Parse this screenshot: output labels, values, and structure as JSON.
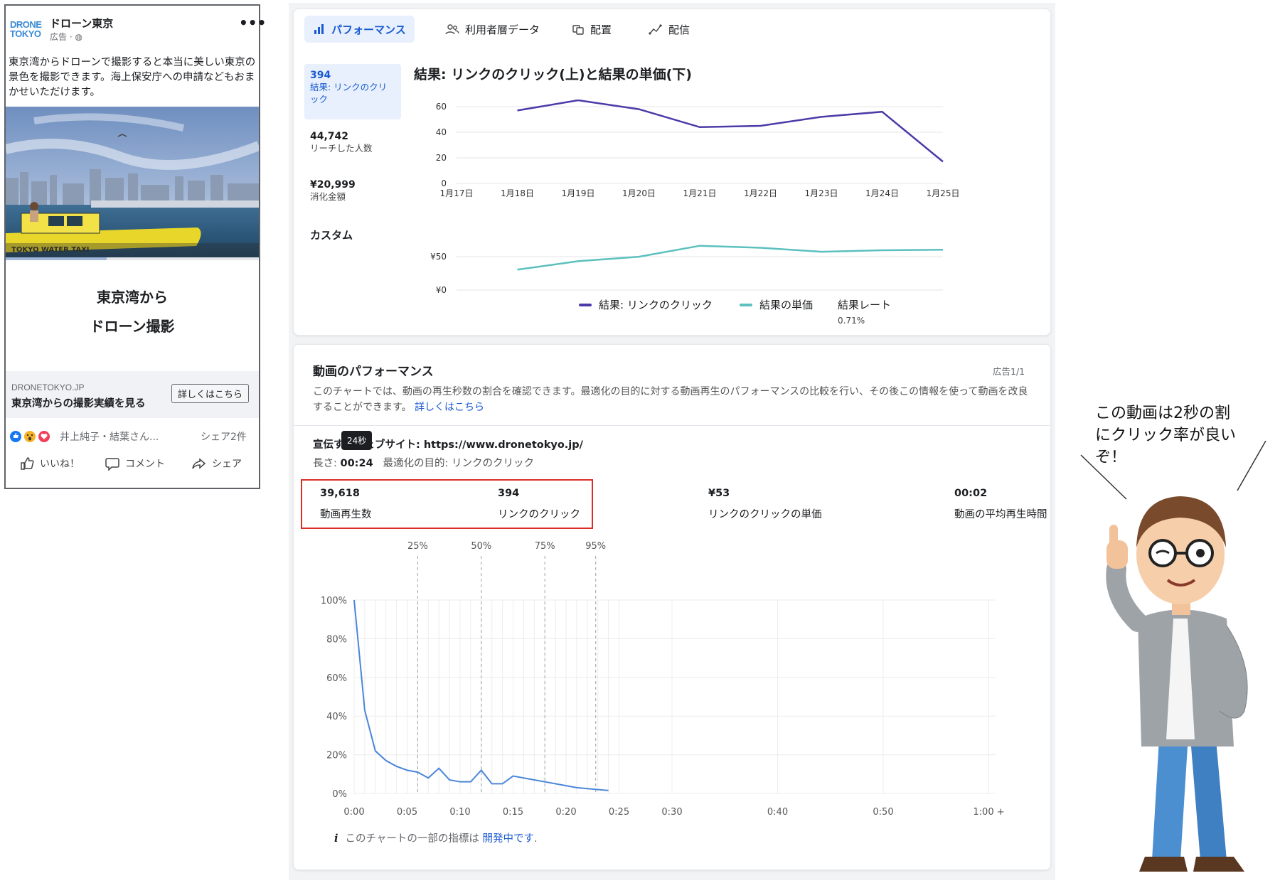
{
  "ad_preview": {
    "logo_text": [
      "DRONE",
      "TOKYO"
    ],
    "page_name": "ドローン東京",
    "sponsored": "広告 · ",
    "more_label": "•••",
    "body_text": "東京湾からドローンで撮影すると本当に美しい東京の景色を撮影できます。海上保安庁への申請などもおまかせいただけます。",
    "boat_text": "TOKYO WATER TAXI",
    "headline_line1": "東京湾から",
    "headline_line2": "ドローン撮影",
    "domain": "DRONETOKYO.JP",
    "cta_title": "東京湾からの撮影実績を見る",
    "cta_button": "詳しくはこちら",
    "reaction_names": "井上純子・結葉さん...",
    "share_count": "シェア2件",
    "actions": {
      "like": "いいね！",
      "comment": "コメント",
      "share": "シェア"
    }
  },
  "tabs": [
    {
      "label": "パフォーマンス",
      "icon": "bar-chart-icon",
      "active": true
    },
    {
      "label": "利用者層データ",
      "icon": "people-icon"
    },
    {
      "label": "配置",
      "icon": "placement-icon"
    },
    {
      "label": "配信",
      "icon": "delivery-icon"
    }
  ],
  "metrics_sidebar": [
    {
      "value": "394",
      "label": "結果: リンクのクリック",
      "selected": true
    },
    {
      "value": "44,742",
      "label": "リーチした人数"
    },
    {
      "value": "¥20,999",
      "label": "消化金額"
    },
    {
      "value": "カスタム",
      "label": ""
    }
  ],
  "performance_chart": {
    "title": "結果: リンクのクリック(上)と結果の単価(下)",
    "legend": {
      "clicks": "結果: リンクのクリック",
      "cpc": "結果の単価",
      "rate_label": "結果レート",
      "rate_value": "0.71%"
    },
    "colors": {
      "clicks": "#4b3aa8",
      "cpc": "#5bc0be"
    }
  },
  "chart_data": [
    {
      "type": "line",
      "x": [
        "1月17日",
        "1月18日",
        "1月19日",
        "1月20日",
        "1月21日",
        "1月22日",
        "1月23日",
        "1月24日",
        "1月25日"
      ],
      "y_ticks": [
        0,
        20,
        40,
        60
      ],
      "ylim": [
        0,
        70
      ],
      "series": [
        {
          "name": "結果: リンクのクリック",
          "values": [
            null,
            57,
            65,
            58,
            44,
            45,
            52,
            56,
            17
          ]
        }
      ]
    },
    {
      "type": "line",
      "x": [
        "1月17日",
        "1月18日",
        "1月19日",
        "1月20日",
        "1月21日",
        "1月22日",
        "1月23日",
        "1月24日",
        "1月25日"
      ],
      "y_ticks": [
        "¥0",
        "¥50"
      ],
      "ylim": [
        0,
        100
      ],
      "series": [
        {
          "name": "結果の単価",
          "values": [
            null,
            41,
            58,
            67,
            89,
            85,
            77,
            80,
            81
          ]
        }
      ]
    },
    {
      "type": "line",
      "title": "",
      "x_ticks": [
        "0:00",
        "0:05",
        "0:10",
        "0:15",
        "0:20",
        "0:25",
        "0:30",
        "0:40",
        "0:50",
        "1:00 +"
      ],
      "y_ticks": [
        "0%",
        "20%",
        "40%",
        "60%",
        "80%",
        "100%"
      ],
      "markers": [
        "25%",
        "50%",
        "75%",
        "95%"
      ],
      "series": [
        {
          "name": "",
          "x_seconds": [
            0,
            1,
            2,
            3,
            4,
            5,
            6,
            7,
            8,
            9,
            10,
            11,
            12,
            13,
            14,
            15,
            16,
            17,
            18,
            19,
            20,
            21,
            22,
            23,
            24
          ],
          "values": [
            100,
            43,
            22,
            17,
            14,
            12,
            11,
            8,
            13,
            7,
            6,
            6,
            12,
            5,
            5,
            9,
            8,
            7,
            6,
            5,
            4,
            3,
            2.5,
            2,
            1.5
          ]
        }
      ]
    }
  ],
  "video_section": {
    "title": "動画のパフォーマンス",
    "ad_counter": "広告1/1",
    "description": "このチャートでは、動画の再生秒数の割合を確認できます。最適化の目的に対する動画再生のパフォーマンスの比較を行い、その後この情報を使って動画を改良することができます。",
    "learn_more": "詳しくはこちら",
    "ad_line": "宣伝するウェブサイト: https://www.dronetokyo.jp/",
    "length_label": "長さ: ",
    "length_value": "00:24",
    "goal_text": "最適化の目的: リンクのクリック",
    "tooltip": "24秒",
    "kpis": [
      {
        "value": "39,618",
        "label": "動画再生数"
      },
      {
        "value": "394",
        "label": "リンクのクリック"
      },
      {
        "value": "¥53",
        "label": "リンクのクリックの単価"
      },
      {
        "value": "00:02",
        "label": "動画の平均再生時間"
      }
    ],
    "footer_prefix": "このチャートの一部の指標は",
    "footer_link": "開発中です",
    "footer_suffix": ".",
    "line_color": "#4a86d8"
  },
  "speech": "この動画は2秒の割にクリック率が良いぞ！"
}
